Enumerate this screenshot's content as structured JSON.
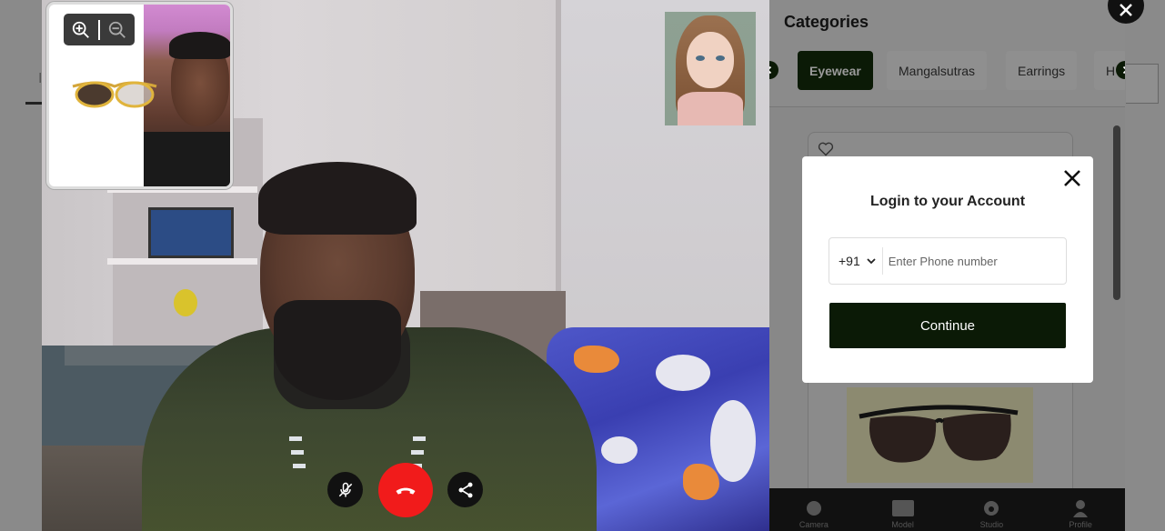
{
  "background": {
    "tab_letter": "I"
  },
  "call_controls": {
    "mute_icon": "mic-off-icon",
    "end_icon": "phone-hangup-icon",
    "share_icon": "share-icon"
  },
  "ar_preview": {
    "zoom_in_icon": "zoom-in-icon",
    "zoom_out_icon": "zoom-out-icon"
  },
  "side_panel": {
    "title": "Categories",
    "categories": [
      {
        "label": "Eyewear",
        "active": true
      },
      {
        "label": "Mangalsutras",
        "active": false
      },
      {
        "label": "Earrings",
        "active": false
      },
      {
        "label": "H",
        "active": false
      }
    ],
    "bottom_nav": [
      {
        "label": "Camera",
        "icon": "camera-icon"
      },
      {
        "label": "Model",
        "icon": "image-icon"
      },
      {
        "label": "Studio",
        "icon": "studio-icon"
      },
      {
        "label": "Profile",
        "icon": "user-icon"
      }
    ]
  },
  "login": {
    "title": "Login to your Account",
    "country_code": "+91",
    "phone_placeholder": "Enter Phone number",
    "phone_value": "",
    "continue_label": "Continue"
  },
  "colors": {
    "accent": "#0b1a06",
    "end_call": "#f11b1b"
  }
}
